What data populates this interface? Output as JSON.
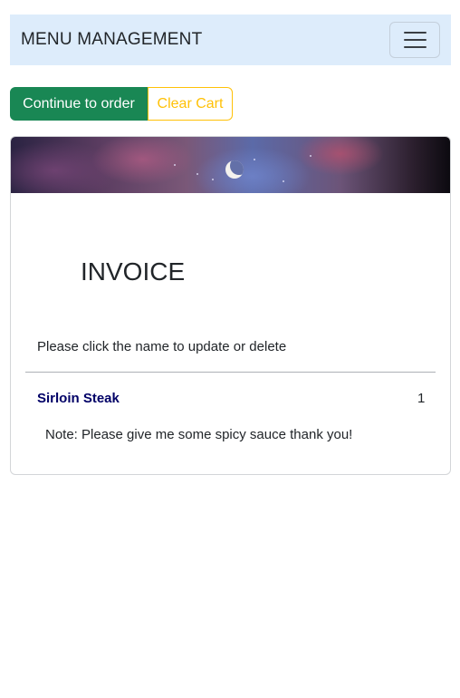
{
  "navbar": {
    "brand": "MENU MANAGEMENT",
    "toggler_icon": "hamburger-menu-icon",
    "background": "#ddecfb"
  },
  "actions": {
    "continue_label": "Continue to order",
    "clear_label": "Clear Cart",
    "continue_color": "#198754",
    "clear_color": "#ffc107"
  },
  "invoice": {
    "title": "INVOICE",
    "instruction": "Please click the name to update or delete",
    "items": [
      {
        "name": "Sirloin Steak",
        "quantity": "1",
        "note": "Note: Please give me some spicy sauce thank you!",
        "name_color": "#000066"
      }
    ]
  }
}
